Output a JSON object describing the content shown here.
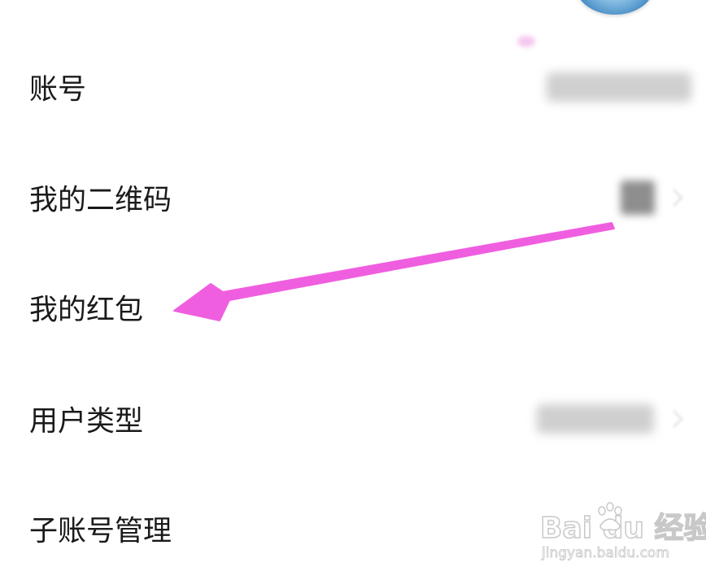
{
  "settings": {
    "rows": [
      {
        "label": "账号"
      },
      {
        "label": "我的二维码"
      },
      {
        "label": "我的红包"
      },
      {
        "label": "用户类型"
      },
      {
        "label": "子账号管理"
      }
    ]
  },
  "annotation": {
    "arrow_color": "#f05ee0",
    "points_to": "我的红包"
  },
  "watermark": {
    "logo": "Bai du 经验",
    "url": "jingyan.baidu.com"
  },
  "icons": {
    "avatar": "avatar-icon",
    "chevron": "chevron-right-icon",
    "qr": "qr-code-icon",
    "paw": "baidu-paw-icon"
  },
  "colors": {
    "text": "#1a1a1a",
    "avatar": "#4a8fc8",
    "background": "#ffffff"
  }
}
